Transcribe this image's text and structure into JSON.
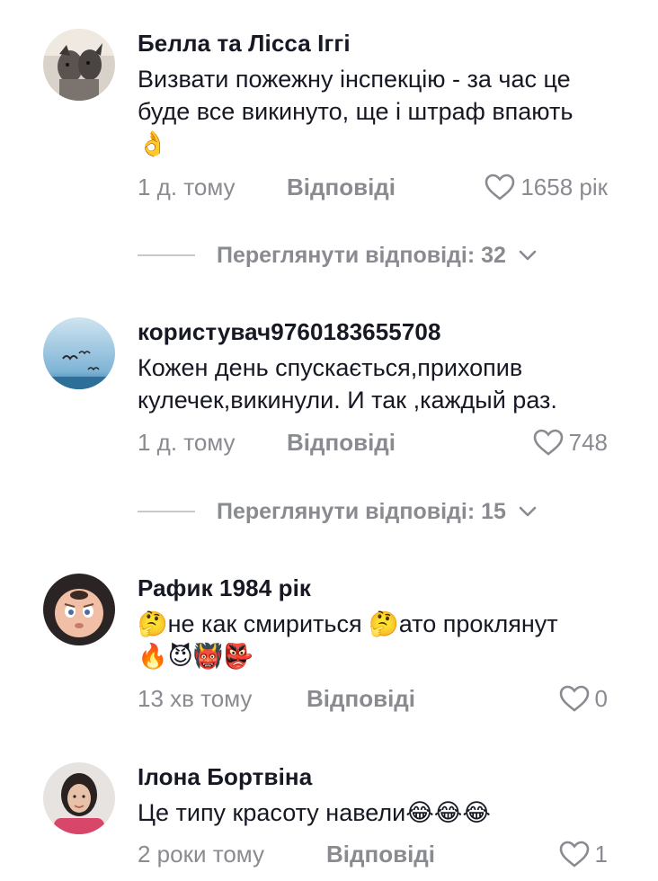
{
  "comments": [
    {
      "username": "Белла та Лісса Іггі",
      "text": "Визвати пожежну інспекцію - за час це буде все викинуто, ще і штраф впають",
      "emoji_suffix": "👌",
      "time": "1 д. тому",
      "reply_label": "Відповіді",
      "likes": "1658 рік",
      "avatar": "two-dogs-photo"
    },
    {
      "username": "користувач9760183655708",
      "text": "Кожен день спускається,прихопив кулечек,викинули. И так ,каждый раз.",
      "time": "1 д. тому",
      "reply_label": "Відповіді",
      "likes": "748",
      "avatar": "seagulls-sky-photo"
    },
    {
      "username": "Рафик 1984 рік",
      "text_prefix_emoji": "🤔",
      "text": "не как смириться ",
      "text_mid_emoji": "🤔",
      "text_after": "ато проклянут",
      "emoji_line": "🔥😈👹👺",
      "time": "13 хв тому",
      "reply_label": "Відповіді",
      "likes": "0",
      "avatar": "cartoon-baby-photo"
    },
    {
      "username": "Ілона Бортвіна",
      "text": "Це типу красоту навели",
      "emoji_suffix": "😂😂😂",
      "time": "2 роки тому",
      "reply_label": "Відповіді",
      "likes": "1",
      "avatar": "woman-portrait-photo"
    }
  ],
  "view_replies": [
    {
      "label": "Переглянути відповіді: 32"
    },
    {
      "label": "Переглянути відповіді: 15"
    }
  ],
  "colors": {
    "text": "#161823",
    "muted": "#8a8b91",
    "divider": "#c9c9cd"
  }
}
